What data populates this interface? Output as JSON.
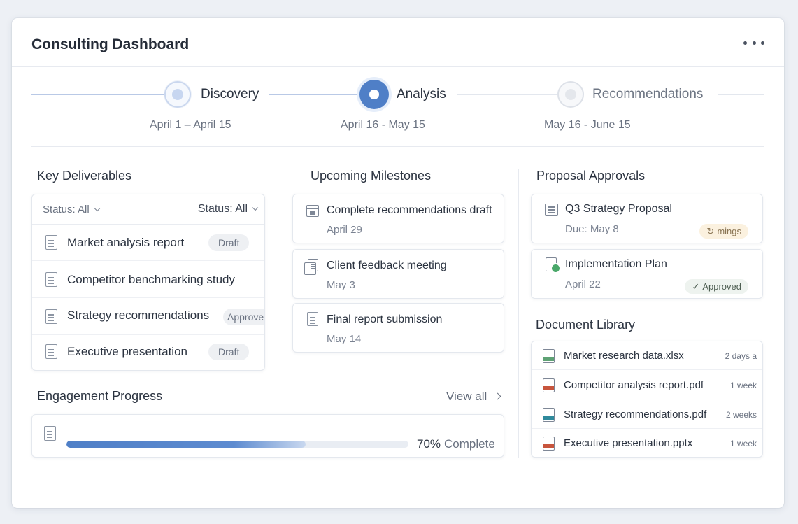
{
  "header": {
    "title": "Consulting Dashboard",
    "menu_icon": "more-horizontal-icon"
  },
  "stepper": {
    "steps": [
      {
        "label": "Discovery",
        "dates": "April 1 – April 15",
        "state": "done"
      },
      {
        "label": "Analysis",
        "dates": "April 16 - May 15",
        "state": "active"
      },
      {
        "label": "Recommendations",
        "dates": "May 16 - June 15",
        "state": "todo"
      }
    ]
  },
  "deliverables": {
    "title": "Key Deliverables",
    "filters": [
      "Status: All",
      "Status: All"
    ],
    "items": [
      {
        "name": "Market analysis report",
        "status": "Draft"
      },
      {
        "name": "Competitor benchmarking study",
        "status": ""
      },
      {
        "name": "Strategy recommendations",
        "status": "Approved"
      },
      {
        "name": "Executive presentation",
        "status": "Draft"
      }
    ]
  },
  "milestones": {
    "title": "Upcoming Milestones",
    "items": [
      {
        "name": "Complete recommendations draft",
        "date": "April 29",
        "icon": "calendar-icon"
      },
      {
        "name": "Client feedback meeting",
        "date": "May 3",
        "icon": "copy-icon"
      },
      {
        "name": "Final report submission",
        "date": "May 14",
        "icon": "document-icon"
      }
    ]
  },
  "engagement": {
    "title": "Engagement Progress",
    "view_all": "View all",
    "progress_fraction": 0.7,
    "percent": "70%",
    "complete_label": "Complete"
  },
  "approvals": {
    "title": "Proposal Approvals",
    "items": [
      {
        "name": "Q3 Strategy Proposal",
        "date": "Due: May 8",
        "status": "mings",
        "status_icon": "refresh-icon",
        "tone": "warn"
      },
      {
        "name": "Implementation Plan",
        "date": "April 22",
        "status": "Approved",
        "status_icon": "check-icon",
        "tone": "ok"
      }
    ]
  },
  "library": {
    "title": "Document Library",
    "files": [
      {
        "name": "Market research data.xlsx",
        "time": "2 days a",
        "type": "xlsx"
      },
      {
        "name": "Competitor analysis report.pdf",
        "time": "1 week",
        "type": "pdf"
      },
      {
        "name": "Strategy recommendations.pdf",
        "time": "2 weeks",
        "type": "pdf2"
      },
      {
        "name": "Executive presentation.pptx",
        "time": "1 week",
        "type": "pptx"
      }
    ]
  },
  "colors": {
    "accent": "#4f7fc7",
    "approved_bg": "#eef3ef",
    "pending_bg": "#fbf1df"
  }
}
